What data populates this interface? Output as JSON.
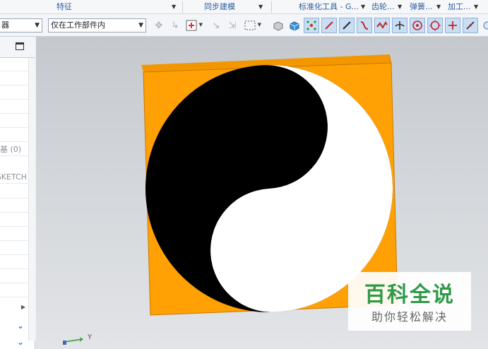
{
  "ribbon_groups": [
    {
      "label": "特征"
    },
    {
      "label": "同步建模"
    },
    {
      "label": "标准化工具 - G..."
    },
    {
      "label": "齿轮..."
    },
    {
      "label": "弹簧..."
    },
    {
      "label": "加工..."
    }
  ],
  "toolbar": {
    "filter_value": "器",
    "scope_value": "仅在工作部件内",
    "icons": [
      "move-icon",
      "snap-icon",
      "insert-point-icon",
      "snap-arrow-icon",
      "merge-icon",
      "select-box-icon",
      "block-icon",
      "solid-icon",
      "grid-points-icon",
      "line-icon",
      "draw-line-icon",
      "spline-icon",
      "wave-icon",
      "intersection-icon",
      "target-center-icon",
      "circle-icon",
      "crosshair-icon",
      "slash-icon",
      "zoom-icon"
    ]
  },
  "navigator": {
    "rows": [
      "",
      "",
      "",
      "",
      "",
      "",
      "(0) 基",
      "SKETCH",
      "",
      "",
      "",
      "",
      "",
      "",
      "",
      "",
      "",
      "",
      ""
    ]
  },
  "viewport": {
    "model": "taiji-plate",
    "colors": {
      "frame": "#ffa004",
      "frame_side": "#e88d00",
      "yin": "#000000",
      "yang": "#ffffff"
    },
    "triad_axis": "Y"
  },
  "watermark": {
    "title": "百科全说",
    "subtitle": "助你轻松解决"
  }
}
